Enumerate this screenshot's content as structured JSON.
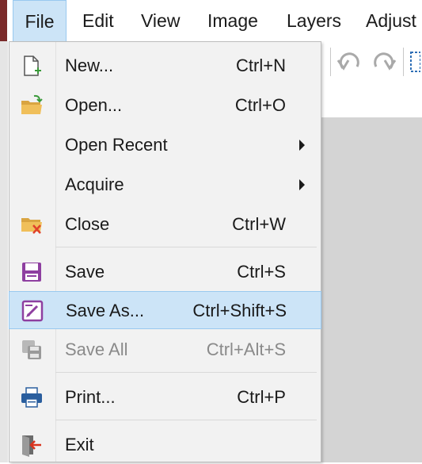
{
  "menubar": {
    "items": [
      "File",
      "Edit",
      "View",
      "Image",
      "Layers",
      "Adjust"
    ]
  },
  "file_menu": {
    "items": [
      {
        "label": "New...",
        "shortcut": "Ctrl+N",
        "icon": "new-file-icon"
      },
      {
        "label": "Open...",
        "shortcut": "Ctrl+O",
        "icon": "open-folder-icon"
      },
      {
        "label": "Open Recent",
        "shortcut": "",
        "icon": "",
        "submenu": true
      },
      {
        "label": "Acquire",
        "shortcut": "",
        "icon": "",
        "submenu": true
      },
      {
        "label": "Close",
        "shortcut": "Ctrl+W",
        "icon": "close-folder-icon"
      },
      {
        "label": "Save",
        "shortcut": "Ctrl+S",
        "icon": "save-icon"
      },
      {
        "label": "Save As...",
        "shortcut": "Ctrl+Shift+S",
        "icon": "save-as-icon",
        "highlighted": true
      },
      {
        "label": "Save All",
        "shortcut": "Ctrl+Alt+S",
        "icon": "save-all-icon",
        "disabled": true
      },
      {
        "label": "Print...",
        "shortcut": "Ctrl+P",
        "icon": "printer-icon"
      },
      {
        "label": "Exit",
        "shortcut": "",
        "icon": "exit-icon"
      }
    ]
  },
  "colors": {
    "highlight": "#cce4f7",
    "highlight_border": "#99c9ef",
    "menu_bg": "#f2f2f2",
    "disabled_text": "#8a8a8a"
  }
}
